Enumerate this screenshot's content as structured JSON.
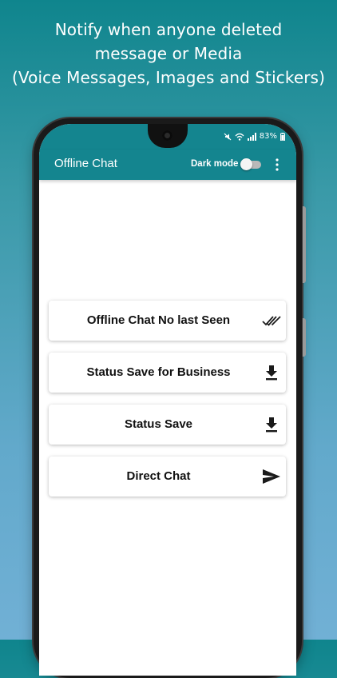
{
  "promo": {
    "line1": "Notify when anyone deleted",
    "line2": "message or Media",
    "line3": "(Voice Messages, Images and Stickers)"
  },
  "status_bar": {
    "battery": "83%",
    "icons": [
      "mute-icon",
      "wifi-icon",
      "signal-icon",
      "battery-icon"
    ]
  },
  "app_bar": {
    "title": "Offline Chat",
    "dark_mode_label": "Dark mode",
    "dark_mode_on": false,
    "menu_icon": "more-vert-icon"
  },
  "menu_items": [
    {
      "label": "Offline Chat No last Seen",
      "icon": "double-check-icon"
    },
    {
      "label": "Status Save for Business",
      "icon": "download-icon"
    },
    {
      "label": "Status Save",
      "icon": "download-icon"
    },
    {
      "label": "Direct Chat",
      "icon": "send-icon"
    }
  ],
  "colors": {
    "app_bar": "#14858f",
    "background_top": "#0f858d",
    "background_bottom": "#71b0d5",
    "icon": "#1a1a1a"
  }
}
